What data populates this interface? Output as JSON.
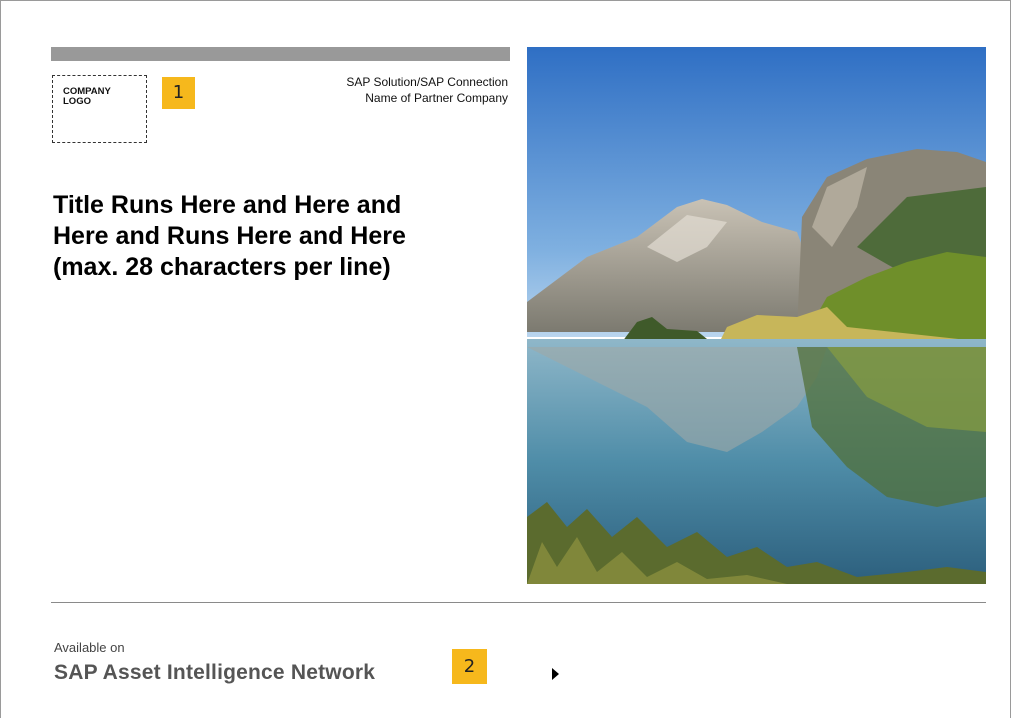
{
  "header": {
    "logo_lines": [
      "COMPANY",
      "LOGO"
    ],
    "badge_1": "1",
    "partner_lines": [
      "SAP Solution/SAP Connection",
      "Name of Partner Company"
    ]
  },
  "title": {
    "lines": [
      "Title Runs Here and Here and",
      "Here and Runs Here and Here",
      "(max. 28 characters per line)"
    ]
  },
  "hero": {
    "description": "mountain-lake-reflection",
    "colors": {
      "sky_top": "#2f6fc4",
      "sky_bottom": "#a9cbe8",
      "mountain": "#9a948a",
      "foliage": "#6f8f2a",
      "water": "#4f8da8"
    }
  },
  "footer": {
    "available_label": "Available on",
    "network_name": "SAP Asset Intelligence Network",
    "badge_2": "2",
    "arrow_icon": "play-arrow-icon",
    "colors": {
      "badge": "#f6b81c"
    }
  }
}
